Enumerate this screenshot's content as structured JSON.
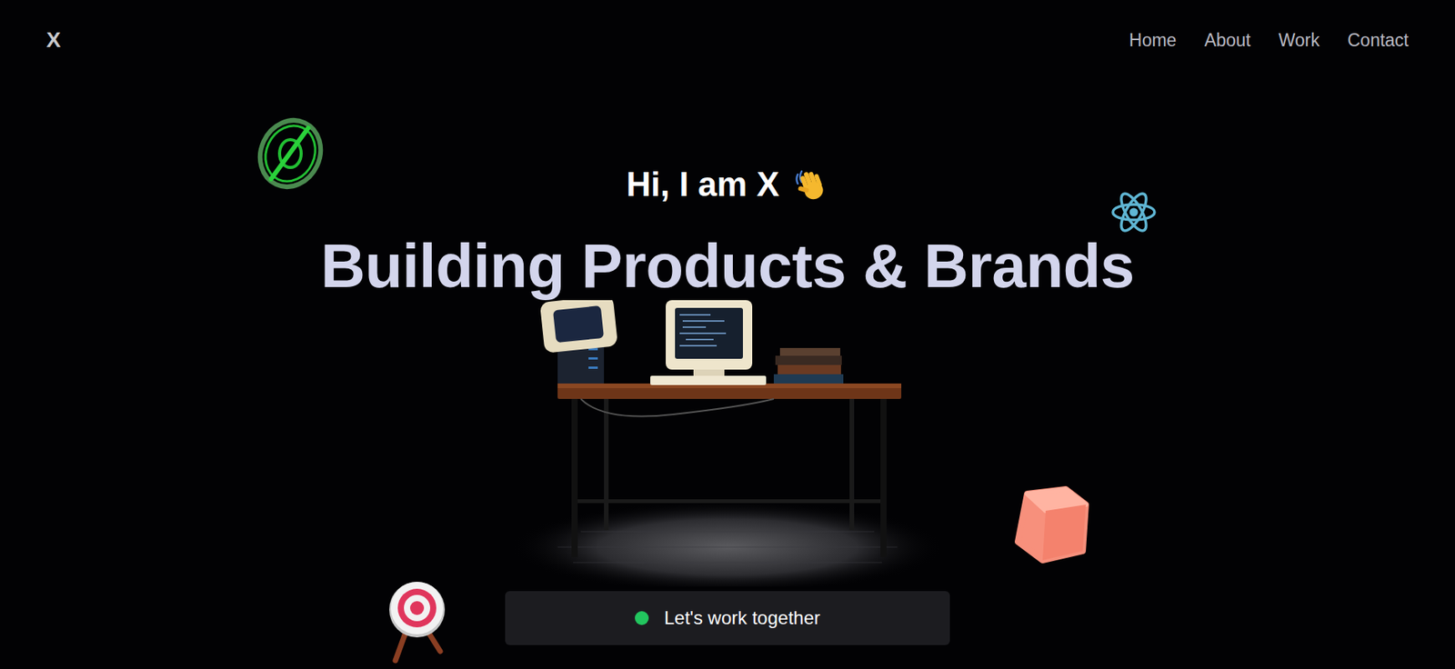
{
  "logo": "X",
  "nav": [
    {
      "label": "Home"
    },
    {
      "label": "About"
    },
    {
      "label": "Work"
    },
    {
      "label": "Contact"
    }
  ],
  "greeting": "Hi, I am X",
  "headline": "Building Products & Brands",
  "cta": {
    "label": "Let's work together"
  }
}
